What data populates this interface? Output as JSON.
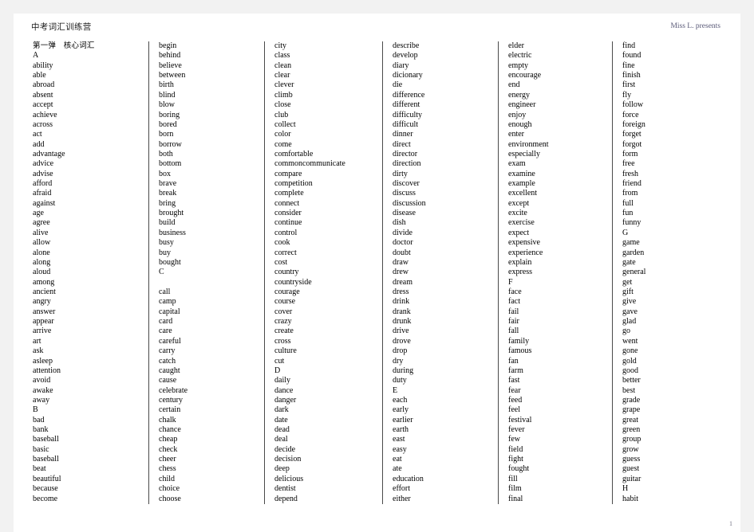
{
  "document": {
    "title": "中考词汇训练营",
    "byline": "Miss L. presents",
    "page_number": "1",
    "section_heading": "第一弹　核心词汇"
  },
  "columns": [
    {
      "id": "column-1",
      "words": [
        "A",
        "ability",
        "able",
        "abroad",
        "absent",
        "accept",
        "achieve",
        "across",
        "act",
        "add",
        "advantage",
        "advice",
        "advise",
        "afford",
        "afraid",
        "against",
        "age",
        "agree",
        "alive",
        "allow",
        "alone",
        "along",
        "aloud",
        "among",
        "ancient",
        "angry",
        "answer",
        "appear",
        "arrive",
        "art",
        "ask",
        "asleep",
        "attention",
        "avoid",
        "awake",
        "away",
        "B",
        "bad",
        "bank",
        "baseball",
        "basic",
        "baseball",
        "beat",
        "beautiful",
        "because",
        "become"
      ]
    },
    {
      "id": "column-2",
      "words": [
        "begin",
        "behind",
        "believe",
        "between",
        "birth",
        "blind",
        "blow",
        "boring",
        "bored",
        "born",
        "borrow",
        "both",
        "bottom",
        "box",
        "brave",
        "break",
        "bring",
        "brought",
        "build",
        "business",
        "busy",
        "buy",
        "bought",
        "C",
        "",
        "call",
        "camp",
        "capital",
        "card",
        "care",
        "careful",
        "carry",
        "catch",
        "caught",
        "cause",
        "celebrate",
        "century",
        "certain",
        "chalk",
        "chance",
        "cheap",
        "check",
        "cheer",
        "chess",
        "child",
        "choice",
        "choose"
      ]
    },
    {
      "id": "column-3",
      "words": [
        "city",
        "class",
        "clean",
        "clear",
        "clever",
        "climb",
        "close",
        "club",
        "collect",
        "color",
        "come",
        "comfortable",
        "commoncommunicate",
        "compare",
        "competition",
        "complete",
        "connect",
        "consider",
        "continue",
        "control",
        "cook",
        "correct",
        "cost",
        "country",
        "countryside",
        "courage",
        "course",
        "cover",
        "crazy",
        "create",
        "cross",
        "culture",
        "cut",
        "D",
        "daily",
        "dance",
        "danger",
        "dark",
        "date",
        "dead",
        "deal",
        "decide",
        "decision",
        "deep",
        "delicious",
        "dentist",
        "depend"
      ]
    },
    {
      "id": "column-4",
      "words": [
        "describe",
        "develop",
        "diary",
        "dicionary",
        "die",
        "difference",
        "different",
        "difficulty",
        "difficult",
        "dinner",
        "direct",
        "director",
        "direction",
        "dirty",
        "discover",
        "discuss",
        "discussion",
        "disease",
        "dish",
        "divide",
        "doctor",
        "doubt",
        "draw",
        "drew",
        "dream",
        "dress",
        "drink",
        "drank",
        "drunk",
        "drive",
        "drove",
        "drop",
        "dry",
        "during",
        "duty",
        "E",
        "each",
        "early",
        "earlier",
        "earth",
        "east",
        "easy",
        "eat",
        "ate",
        "education",
        "effort",
        "either"
      ]
    },
    {
      "id": "column-5",
      "words": [
        "elder",
        "electric",
        "empty",
        "encourage",
        "end",
        "energy",
        "engineer",
        "enjoy",
        "enough",
        "enter",
        "environment",
        "especially",
        "exam",
        "examine",
        "example",
        "excellent",
        "except",
        "excite",
        "exercise",
        "expect",
        "expensive",
        "experience",
        "explain",
        "express",
        "F",
        "face",
        "fact",
        "fail",
        "fair",
        "fall",
        "family",
        "famous",
        "fan",
        "farm",
        "fast",
        "fear",
        "feed",
        "feel",
        "festival",
        "fever",
        "few",
        "field",
        "fight",
        "fought",
        "fill",
        "film",
        "final"
      ]
    },
    {
      "id": "column-6",
      "words": [
        "find",
        "found",
        "fine",
        "finish",
        "first",
        "fly",
        "follow",
        "force",
        "foreign",
        "forget",
        "forgot",
        "form",
        "free",
        "fresh",
        "friend",
        "from",
        "full",
        "fun",
        "funny",
        "G",
        "game",
        "garden",
        "gate",
        "general",
        "get",
        "gift",
        "give",
        "gave",
        "glad",
        "go",
        "went",
        "gone",
        "gold",
        "good",
        "better",
        "best",
        "grade",
        "grape",
        "great",
        "green",
        "group",
        "grow",
        "guess",
        "guest",
        "guitar",
        "H",
        "habit"
      ]
    }
  ]
}
